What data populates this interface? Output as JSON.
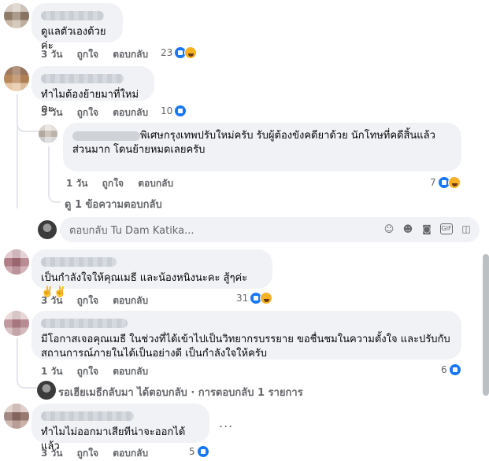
{
  "comments": [
    {
      "text": "ดูแลตัวเองด้วยค่ะ",
      "time": "3 วัน",
      "like": "ถูกใจ",
      "reply": "ตอบกลับ",
      "reaction_count": "23",
      "reactions": [
        "like",
        "haha"
      ]
    },
    {
      "text": "ทำไมต้องย้ายมาที่ใหม่คะ",
      "time": "3 วัน",
      "like": "ถูกใจ",
      "reply": "ตอบกลับ",
      "reaction_count": "10",
      "reactions": [
        "like"
      ],
      "replies": {
        "text": "พิเศษกรุงเทพปรับใหม่ครับ รับผู้ต้องขังคดียาด้วย นักโทษที่คดีสิ้นแล้วส่วนมาก โดนย้ายหมดเลยครับ",
        "time": "1 วัน",
        "like": "ถูกใจ",
        "reply": "ตอบกลับ",
        "reaction_count": "7",
        "reactions": [
          "like",
          "haha"
        ],
        "view_more": "ดู 1 ข้อความตอบกลับ"
      },
      "reply_input_placeholder": "ตอบกลับ Tu Dam Katika..."
    },
    {
      "text": "เป็นกำลังใจให้คุณเมธี และน้องหนิงนะคะ สู้ๆค่ะ ✌️✌️",
      "time": "3 วัน",
      "like": "ถูกใจ",
      "reply": "ตอบกลับ",
      "reaction_count": "31",
      "reactions": [
        "like",
        "haha"
      ]
    },
    {
      "text": "มีโอกาสเจอคุณเมธี ในช่วงที่ได้เข้าไปเป็นวิทยากรบรรยาย ขอชื่นชมในความตั้งใจ และปรับกับสถานการณ์ภายในได้เป็นอย่างดี เป็นกำลังใจให้ครับ",
      "time": "1 วัน",
      "like": "ถูกใจ",
      "reply": "ตอบกลับ",
      "reaction_count": "6",
      "reactions": [
        "like"
      ],
      "reply_summary": "รอเฮียเมธีกลับมา ได้ตอบกลับ · การตอบกลับ 1 รายการ"
    },
    {
      "text": "ทำไมไม่ออกมาเสียทีน่าจะออกได้แล้ว",
      "time": "3 วัน",
      "like": "ถูกใจ",
      "reply": "ตอบกลับ",
      "reaction_count": "5",
      "reactions": [
        "like"
      ],
      "more": "..."
    }
  ],
  "input_icons": [
    "sticker-face-icon",
    "emoji-icon",
    "camera-icon",
    "gif-icon",
    "sticker-icon"
  ],
  "colors": {
    "bubble": "#f0f2f5",
    "meta": "#65676b",
    "like_blue": "#1877f2",
    "haha_yellow": "#f7b125"
  }
}
